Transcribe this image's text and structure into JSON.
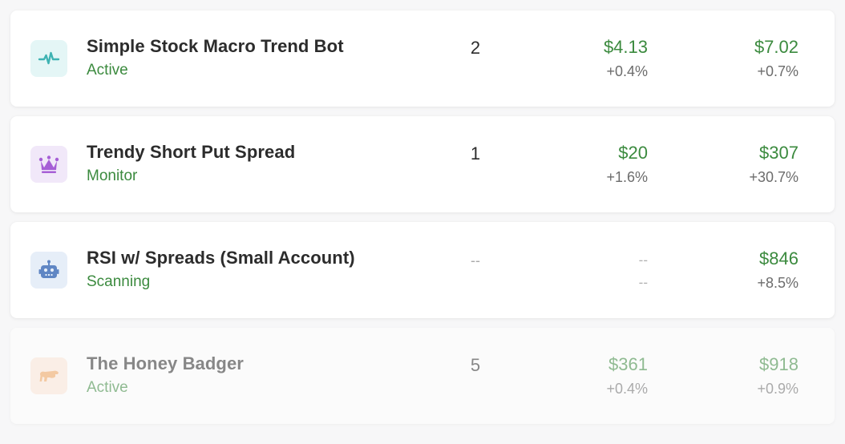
{
  "colors": {
    "positive": "#3b8a3e",
    "muted": "#6c6c6c",
    "teal_icon_bg": "#e4f6f6",
    "purple_icon_bg": "#f1e8f9",
    "blue_icon_bg": "#e6eef8",
    "orange_icon_bg": "#fde8d8"
  },
  "bots": [
    {
      "icon": "pulse-icon",
      "name": "Simple Stock Macro Trend Bot",
      "status": "Active",
      "count": "2",
      "value1": "$4.13",
      "pct1": "+0.4%",
      "value2": "$7.02",
      "pct2": "+0.7%"
    },
    {
      "icon": "crown-icon",
      "name": "Trendy Short Put Spread",
      "status": "Monitor",
      "count": "1",
      "value1": "$20",
      "pct1": "+1.6%",
      "value2": "$307",
      "pct2": "+30.7%"
    },
    {
      "icon": "robot-icon",
      "name": "RSI w/ Spreads (Small Account)",
      "status": "Scanning",
      "count": "--",
      "value1": "--",
      "pct1": "--",
      "value2": "$846",
      "pct2": "+8.5%"
    },
    {
      "icon": "honey-badger-icon",
      "name": "The Honey Badger",
      "status": "Active",
      "count": "5",
      "value1": "$361",
      "pct1": "+0.4%",
      "value2": "$918",
      "pct2": "+0.9%"
    }
  ]
}
